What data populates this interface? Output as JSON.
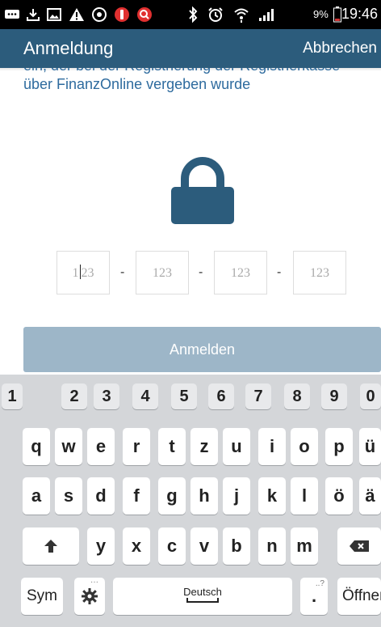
{
  "status_bar": {
    "time": "19:46",
    "battery_percent": "9%",
    "icons": [
      "message-icon",
      "download-icon",
      "image-icon",
      "warning-icon",
      "sync-icon",
      "app-icon",
      "search-app-icon",
      "bluetooth-icon",
      "alarm-icon",
      "wifi-icon",
      "signal-icon",
      "battery-icon"
    ]
  },
  "app_bar": {
    "title": "Anmeldung",
    "cancel_label": "Abbrechen"
  },
  "content": {
    "description": "ein, der bei der Registrierung der Registrierkasse über FinanzOnline vergeben wurde",
    "pin_fields": [
      {
        "value": "123",
        "placeholder": "123"
      },
      {
        "value": "",
        "placeholder": "123"
      },
      {
        "value": "",
        "placeholder": "123"
      },
      {
        "value": "",
        "placeholder": "123"
      }
    ],
    "separator": "-",
    "login_button": "Anmelden"
  },
  "keyboard": {
    "numbers": [
      "1",
      "2",
      "3",
      "4",
      "5",
      "6",
      "7",
      "8",
      "9",
      "0"
    ],
    "row1": [
      "q",
      "w",
      "e",
      "r",
      "t",
      "z",
      "u",
      "i",
      "o",
      "p",
      "ü"
    ],
    "row2": [
      "a",
      "s",
      "d",
      "f",
      "g",
      "h",
      "j",
      "k",
      "l",
      "ö",
      "ä"
    ],
    "row3": [
      "y",
      "x",
      "c",
      "v",
      "b",
      "n",
      "m"
    ],
    "sym_label": "Sym",
    "space_label": "Deutsch",
    "punct_label": ".",
    "punct_hint": "..?",
    "action_label": "Öffnen",
    "accent_color": "#2c5c7c"
  }
}
